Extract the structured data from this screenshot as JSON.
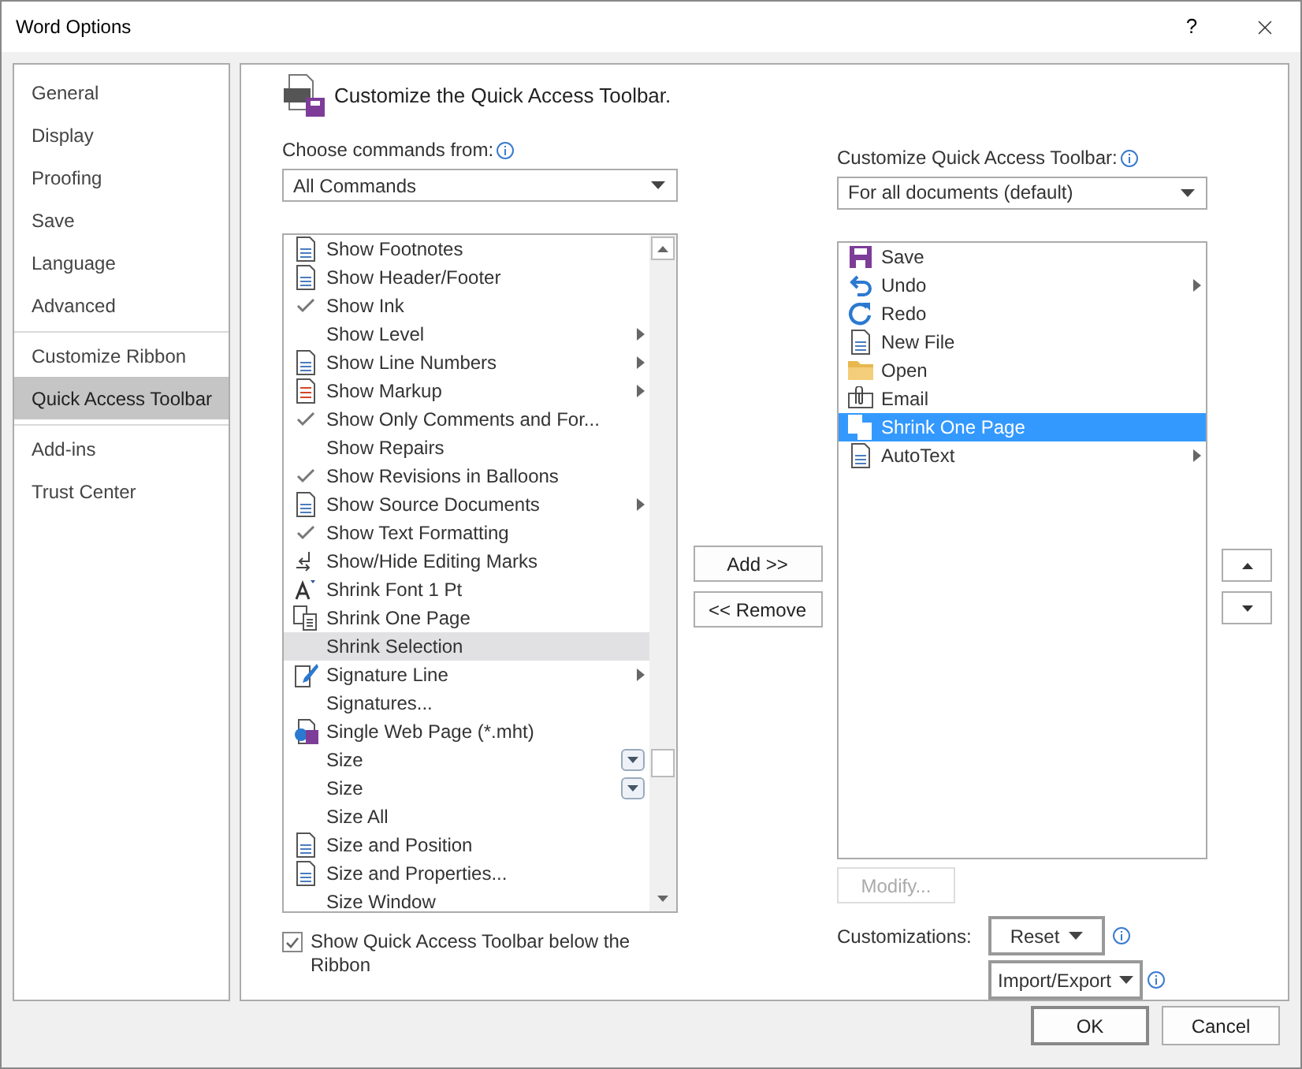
{
  "window": {
    "title": "Word Options",
    "help": "?"
  },
  "sidebar": {
    "groups": [
      [
        {
          "label": "General",
          "selected": false
        },
        {
          "label": "Display",
          "selected": false
        },
        {
          "label": "Proofing",
          "selected": false
        },
        {
          "label": "Save",
          "selected": false
        },
        {
          "label": "Language",
          "selected": false
        },
        {
          "label": "Advanced",
          "selected": false
        }
      ],
      [
        {
          "label": "Customize Ribbon",
          "selected": false
        },
        {
          "label": "Quick Access Toolbar",
          "selected": true
        }
      ],
      [
        {
          "label": "Add-ins",
          "selected": false
        },
        {
          "label": "Trust Center",
          "selected": false
        }
      ]
    ]
  },
  "heading": "Customize the Quick Access Toolbar.",
  "choose_label": "Choose commands from:",
  "choose_value": "All Commands",
  "commands": [
    {
      "label": "Show Footnotes",
      "kind": "page",
      "submenu": false,
      "selected": false
    },
    {
      "label": "Show Header/Footer",
      "kind": "page",
      "submenu": false,
      "selected": false
    },
    {
      "label": "Show Ink",
      "kind": "check",
      "submenu": false,
      "selected": false
    },
    {
      "label": "Show Level",
      "submenu": true,
      "selected": false
    },
    {
      "label": "Show Line Numbers",
      "kind": "page",
      "submenu": true,
      "selected": false
    },
    {
      "label": "Show Markup",
      "kind": "markup",
      "submenu": true,
      "selected": false
    },
    {
      "label": "Show Only Comments and For...",
      "kind": "check",
      "submenu": false,
      "selected": false
    },
    {
      "label": "Show Repairs",
      "submenu": false,
      "selected": false
    },
    {
      "label": "Show Revisions in Balloons",
      "kind": "check",
      "submenu": false,
      "selected": false
    },
    {
      "label": "Show Source Documents",
      "kind": "page",
      "submenu": true,
      "selected": false
    },
    {
      "label": "Show Text Formatting",
      "kind": "check",
      "submenu": false,
      "selected": false
    },
    {
      "label": "Show/Hide Editing Marks",
      "kind": "marks",
      "submenu": false,
      "selected": false
    },
    {
      "label": "Shrink Font 1 Pt",
      "kind": "font",
      "submenu": false,
      "selected": false
    },
    {
      "label": "Shrink One Page",
      "kind": "pages",
      "submenu": false,
      "selected": false
    },
    {
      "label": "Shrink Selection",
      "submenu": false,
      "selected": true
    },
    {
      "label": "Signature Line",
      "kind": "pen",
      "submenu": true,
      "selected": false
    },
    {
      "label": "Signatures...",
      "submenu": false,
      "selected": false
    },
    {
      "label": "Single Web Page (*.mht)",
      "kind": "webpage",
      "submenu": false,
      "selected": false
    },
    {
      "label": "Size",
      "dropdown": true,
      "submenu": false,
      "selected": false
    },
    {
      "label": "Size",
      "dropdown": true,
      "submenu": false,
      "selected": false
    },
    {
      "label": "Size All",
      "submenu": false,
      "selected": false
    },
    {
      "label": "Size and Position",
      "kind": "page",
      "submenu": false,
      "selected": false
    },
    {
      "label": "Size and Properties...",
      "kind": "page",
      "submenu": false,
      "selected": false
    },
    {
      "label": "Size Window",
      "submenu": false,
      "selected": false
    }
  ],
  "below_ribbon": {
    "label": "Show Quick Access Toolbar below the Ribbon",
    "checked": true
  },
  "add_button": "Add >>",
  "remove_button": "<< Remove",
  "toolbar_label": "Customize Quick Access Toolbar:",
  "toolbar_value": "For all documents (default)",
  "toolbar_items": [
    {
      "label": "Save",
      "kind": "save",
      "submenu": false,
      "selected": false
    },
    {
      "label": "Undo",
      "kind": "undo",
      "submenu": true,
      "selected": false
    },
    {
      "label": "Redo",
      "kind": "redo",
      "submenu": false,
      "selected": false
    },
    {
      "label": "New File",
      "kind": "page",
      "submenu": false,
      "selected": false
    },
    {
      "label": "Open",
      "kind": "folder",
      "submenu": false,
      "selected": false
    },
    {
      "label": "Email",
      "kind": "clip",
      "submenu": false,
      "selected": false
    },
    {
      "label": "Shrink One Page",
      "kind": "pages",
      "submenu": false,
      "selected": true
    },
    {
      "label": "AutoText",
      "kind": "page",
      "submenu": true,
      "selected": false
    }
  ],
  "modify_button": {
    "label": "Modify...",
    "disabled": true
  },
  "customizations_label": "Customizations:",
  "reset_button": "Reset",
  "import_export_button": "Import/Export",
  "ok_button": "OK",
  "cancel_button": "Cancel"
}
